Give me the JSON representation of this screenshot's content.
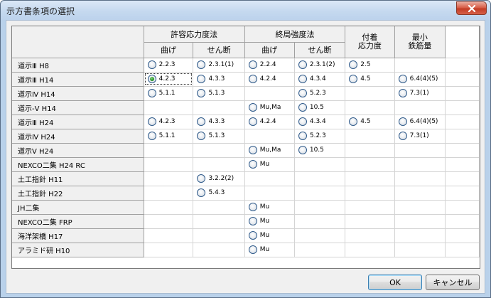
{
  "window": {
    "title": "示方書条項の選択"
  },
  "header": {
    "group1": "許容応力度法",
    "group2": "終局強度法",
    "group3": "付着\n応力度",
    "group4": "最小\n鉄筋量",
    "sub": [
      "曲げ",
      "せん断",
      "曲げ",
      "せん断"
    ]
  },
  "rows": [
    {
      "label": "道示Ⅲ H8",
      "cells": [
        "2.2.3",
        "2.3.1(1)",
        "2.2.4",
        "2.3.1(2)",
        "2.5",
        ""
      ]
    },
    {
      "label": "道示Ⅲ H14",
      "cells": [
        "4.2.3",
        "4.3.3",
        "4.2.4",
        "4.3.4",
        "4.5",
        "6.4(4)(5)"
      ]
    },
    {
      "label": "道示Ⅳ H14",
      "cells": [
        "5.1.1",
        "5.1.3",
        "",
        "5.2.3",
        "",
        "7.3(1)"
      ]
    },
    {
      "label": "道示-Ⅴ H14",
      "cells": [
        "",
        "",
        "Mu,Ma",
        "10.5",
        "",
        ""
      ]
    },
    {
      "label": "道示Ⅲ H24",
      "cells": [
        "4.2.3",
        "4.3.3",
        "4.2.4",
        "4.3.4",
        "4.5",
        "6.4(4)(5)"
      ]
    },
    {
      "label": "道示Ⅳ H24",
      "cells": [
        "5.1.1",
        "5.1.3",
        "",
        "5.2.3",
        "",
        "7.3(1)"
      ]
    },
    {
      "label": "道示Ⅴ H24",
      "cells": [
        "",
        "",
        "Mu,Ma",
        "10.5",
        "",
        ""
      ]
    },
    {
      "label": "NEXCO二集 H24 RC",
      "cells": [
        "",
        "",
        "Mu",
        "",
        "",
        ""
      ]
    },
    {
      "label": "土工指針 H11",
      "cells": [
        "",
        "3.2.2(2)",
        "",
        "",
        "",
        ""
      ]
    },
    {
      "label": "土工指針 H22",
      "cells": [
        "",
        "5.4.3",
        "",
        "",
        "",
        ""
      ]
    },
    {
      "label": "JH二集",
      "cells": [
        "",
        "",
        "Mu",
        "",
        "",
        ""
      ]
    },
    {
      "label": "NEXCO二集 FRP",
      "cells": [
        "",
        "",
        "Mu",
        "",
        "",
        ""
      ]
    },
    {
      "label": "海洋架橋 H17",
      "cells": [
        "",
        "",
        "Mu",
        "",
        "",
        ""
      ]
    },
    {
      "label": "アラミド研 H10",
      "cells": [
        "",
        "",
        "Mu",
        "",
        "",
        ""
      ]
    }
  ],
  "selected": {
    "row": 1,
    "col": 0
  },
  "buttons": {
    "ok": "OK",
    "cancel": "キャンセル"
  }
}
